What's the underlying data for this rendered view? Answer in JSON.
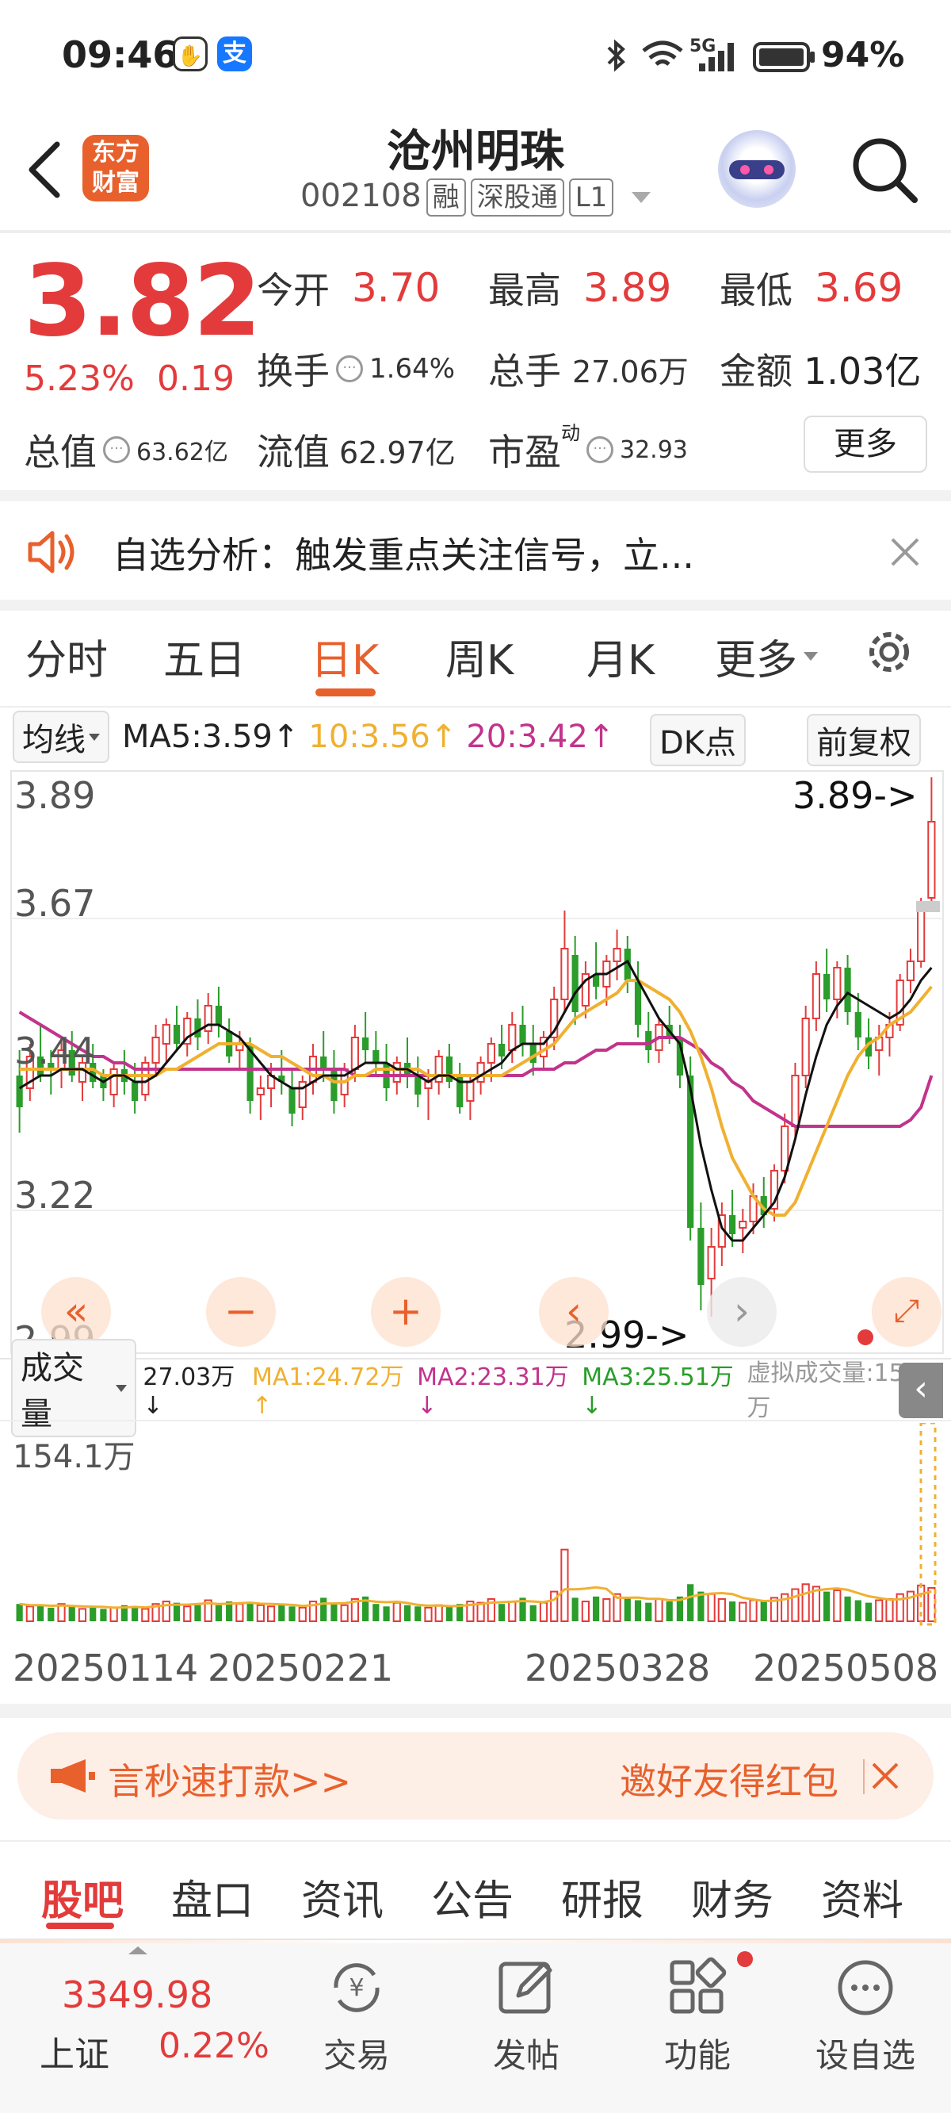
{
  "status_bar": {
    "time": "09:46",
    "badge1": "✋",
    "badge2": "支",
    "network": "5G",
    "battery": "94%"
  },
  "header": {
    "back_icon": "chevron-left-icon",
    "logo_line1": "东方",
    "logo_line2": "财富",
    "title": "沧州明珠",
    "code": "002108",
    "tag_margin": "融",
    "tag_connect": "深股通",
    "tag_level": "L1"
  },
  "quote": {
    "price": "3.82",
    "change_pct": "5.23%",
    "change_amt": "0.19",
    "open_label": "今开",
    "open": "3.70",
    "high_label": "最高",
    "high": "3.89",
    "low_label": "最低",
    "low": "3.69",
    "turnover_label": "换手",
    "turnover": "1.64%",
    "volume_label": "总手",
    "volume": "27.06万",
    "amount_label": "金额",
    "amount": "1.03亿",
    "mcap_label": "总值",
    "mcap": "63.62亿",
    "float_label": "流值",
    "float": "62.97亿",
    "pe_label": "市盈",
    "pe_sup": "动",
    "pe": "32.93",
    "more_label": "更多"
  },
  "notice": {
    "text": "自选分析：触发重点关注信号，立..."
  },
  "chart_tabs": [
    "分时",
    "五日",
    "日K",
    "周K",
    "月K",
    "更多"
  ],
  "active_chart_tab": 2,
  "ma_bar": {
    "mode": "均线",
    "ma5": "MA5:3.59↑",
    "ma10": "10:3.56↑",
    "ma20": "20:3.42↑",
    "dk": "DK点",
    "adjust": "前复权"
  },
  "colors": {
    "up": "#e33b3b",
    "down": "#2a9d2a",
    "accent": "#e8602c",
    "ma5": "#111111",
    "ma10": "#f0b030",
    "ma20": "#c2338c"
  },
  "price_chart": {
    "y_labels": [
      "3.89",
      "3.67",
      "3.44",
      "3.22",
      "2.99"
    ],
    "max_label": "3.89->",
    "min_label": "2.99->"
  },
  "volume_bar": {
    "mode": "成交量",
    "vol": "27.03万↓",
    "ma1": "MA1:24.72万↑",
    "ma2": "MA2:23.31万↓",
    "ma3": "MA3:25.51万↓",
    "virtual": "虚拟成交量:154.1万",
    "max_label": "154.1万"
  },
  "chart_data": {
    "type": "candlestick",
    "ylim": [
      2.99,
      3.89
    ],
    "x_tick_labels": [
      "20250114",
      "20250221",
      "20250328",
      "20250508"
    ],
    "candles": [
      [
        3.42,
        3.46,
        3.33,
        3.37
      ],
      [
        3.4,
        3.47,
        3.38,
        3.45
      ],
      [
        3.45,
        3.5,
        3.41,
        3.42
      ],
      [
        3.44,
        3.46,
        3.39,
        3.43
      ],
      [
        3.43,
        3.48,
        3.4,
        3.46
      ],
      [
        3.46,
        3.49,
        3.41,
        3.42
      ],
      [
        3.41,
        3.45,
        3.38,
        3.44
      ],
      [
        3.44,
        3.47,
        3.4,
        3.41
      ],
      [
        3.42,
        3.43,
        3.38,
        3.4
      ],
      [
        3.39,
        3.44,
        3.37,
        3.43
      ],
      [
        3.43,
        3.46,
        3.39,
        3.41
      ],
      [
        3.41,
        3.44,
        3.36,
        3.38
      ],
      [
        3.39,
        3.45,
        3.38,
        3.44
      ],
      [
        3.44,
        3.5,
        3.42,
        3.48
      ],
      [
        3.47,
        3.51,
        3.44,
        3.5
      ],
      [
        3.5,
        3.53,
        3.46,
        3.47
      ],
      [
        3.47,
        3.52,
        3.45,
        3.51
      ],
      [
        3.51,
        3.54,
        3.46,
        3.48
      ],
      [
        3.49,
        3.55,
        3.47,
        3.53
      ],
      [
        3.53,
        3.56,
        3.48,
        3.5
      ],
      [
        3.49,
        3.51,
        3.44,
        3.45
      ],
      [
        3.46,
        3.49,
        3.43,
        3.47
      ],
      [
        3.47,
        3.48,
        3.36,
        3.38
      ],
      [
        3.39,
        3.42,
        3.35,
        3.4
      ],
      [
        3.4,
        3.44,
        3.37,
        3.42
      ],
      [
        3.42,
        3.46,
        3.39,
        3.41
      ],
      [
        3.4,
        3.43,
        3.34,
        3.36
      ],
      [
        3.37,
        3.42,
        3.35,
        3.41
      ],
      [
        3.41,
        3.47,
        3.39,
        3.45
      ],
      [
        3.45,
        3.49,
        3.41,
        3.43
      ],
      [
        3.43,
        3.46,
        3.36,
        3.38
      ],
      [
        3.39,
        3.44,
        3.37,
        3.43
      ],
      [
        3.43,
        3.5,
        3.41,
        3.48
      ],
      [
        3.48,
        3.52,
        3.44,
        3.46
      ],
      [
        3.46,
        3.49,
        3.42,
        3.44
      ],
      [
        3.44,
        3.47,
        3.38,
        3.4
      ],
      [
        3.41,
        3.45,
        3.39,
        3.44
      ],
      [
        3.44,
        3.48,
        3.4,
        3.42
      ],
      [
        3.42,
        3.45,
        3.37,
        3.39
      ],
      [
        3.4,
        3.43,
        3.35,
        3.41
      ],
      [
        3.41,
        3.46,
        3.39,
        3.45
      ],
      [
        3.45,
        3.47,
        3.4,
        3.41
      ],
      [
        3.42,
        3.44,
        3.36,
        3.37
      ],
      [
        3.38,
        3.42,
        3.35,
        3.41
      ],
      [
        3.41,
        3.45,
        3.39,
        3.44
      ],
      [
        3.44,
        3.48,
        3.41,
        3.47
      ],
      [
        3.47,
        3.5,
        3.43,
        3.45
      ],
      [
        3.46,
        3.52,
        3.44,
        3.5
      ],
      [
        3.5,
        3.53,
        3.45,
        3.47
      ],
      [
        3.47,
        3.5,
        3.42,
        3.44
      ],
      [
        3.45,
        3.49,
        3.43,
        3.48
      ],
      [
        3.48,
        3.56,
        3.46,
        3.54
      ],
      [
        3.54,
        3.68,
        3.52,
        3.62
      ],
      [
        3.61,
        3.64,
        3.5,
        3.52
      ],
      [
        3.53,
        3.6,
        3.51,
        3.58
      ],
      [
        3.58,
        3.63,
        3.54,
        3.56
      ],
      [
        3.56,
        3.61,
        3.53,
        3.6
      ],
      [
        3.6,
        3.65,
        3.57,
        3.62
      ],
      [
        3.62,
        3.64,
        3.55,
        3.57
      ],
      [
        3.57,
        3.6,
        3.48,
        3.5
      ],
      [
        3.49,
        3.52,
        3.44,
        3.46
      ],
      [
        3.46,
        3.51,
        3.44,
        3.5
      ],
      [
        3.5,
        3.53,
        3.47,
        3.48
      ],
      [
        3.48,
        3.5,
        3.4,
        3.42
      ],
      [
        3.42,
        3.45,
        3.16,
        3.18
      ],
      [
        3.18,
        3.22,
        3.05,
        3.09
      ],
      [
        3.1,
        3.18,
        3.04,
        3.15
      ],
      [
        3.15,
        3.22,
        3.12,
        3.2
      ],
      [
        3.2,
        3.24,
        3.15,
        3.17
      ],
      [
        3.18,
        3.21,
        3.14,
        3.19
      ],
      [
        3.19,
        3.25,
        3.17,
        3.23
      ],
      [
        3.23,
        3.26,
        3.18,
        3.2
      ],
      [
        3.21,
        3.28,
        3.19,
        3.27
      ],
      [
        3.27,
        3.36,
        3.25,
        3.34
      ],
      [
        3.34,
        3.44,
        3.32,
        3.42
      ],
      [
        3.42,
        3.53,
        3.4,
        3.51
      ],
      [
        3.51,
        3.6,
        3.49,
        3.58
      ],
      [
        3.58,
        3.62,
        3.52,
        3.54
      ],
      [
        3.54,
        3.6,
        3.51,
        3.59
      ],
      [
        3.59,
        3.61,
        3.5,
        3.52
      ],
      [
        3.52,
        3.55,
        3.46,
        3.48
      ],
      [
        3.48,
        3.51,
        3.43,
        3.45
      ],
      [
        3.46,
        3.5,
        3.42,
        3.48
      ],
      [
        3.48,
        3.52,
        3.45,
        3.5
      ],
      [
        3.5,
        3.58,
        3.49,
        3.57
      ],
      [
        3.57,
        3.62,
        3.55,
        3.6
      ],
      [
        3.6,
        3.7,
        3.59,
        3.68
      ],
      [
        3.7,
        3.89,
        3.69,
        3.82
      ]
    ],
    "ma5": [
      3.4,
      3.41,
      3.42,
      3.42,
      3.43,
      3.43,
      3.43,
      3.42,
      3.41,
      3.42,
      3.42,
      3.41,
      3.41,
      3.42,
      3.44,
      3.46,
      3.48,
      3.49,
      3.5,
      3.5,
      3.49,
      3.48,
      3.46,
      3.44,
      3.42,
      3.41,
      3.4,
      3.4,
      3.41,
      3.42,
      3.42,
      3.42,
      3.43,
      3.44,
      3.44,
      3.44,
      3.43,
      3.43,
      3.42,
      3.41,
      3.42,
      3.42,
      3.41,
      3.41,
      3.42,
      3.43,
      3.44,
      3.46,
      3.47,
      3.47,
      3.47,
      3.49,
      3.52,
      3.55,
      3.57,
      3.58,
      3.58,
      3.59,
      3.6,
      3.57,
      3.54,
      3.51,
      3.49,
      3.47,
      3.4,
      3.31,
      3.24,
      3.18,
      3.16,
      3.16,
      3.18,
      3.2,
      3.22,
      3.26,
      3.32,
      3.39,
      3.45,
      3.5,
      3.53,
      3.55,
      3.54,
      3.53,
      3.52,
      3.51,
      3.52,
      3.54,
      3.57,
      3.59
    ],
    "ma10": [
      3.43,
      3.43,
      3.43,
      3.43,
      3.43,
      3.43,
      3.43,
      3.43,
      3.42,
      3.42,
      3.42,
      3.42,
      3.42,
      3.42,
      3.43,
      3.43,
      3.44,
      3.45,
      3.46,
      3.47,
      3.47,
      3.47,
      3.47,
      3.46,
      3.45,
      3.45,
      3.44,
      3.43,
      3.42,
      3.42,
      3.41,
      3.41,
      3.42,
      3.42,
      3.43,
      3.43,
      3.43,
      3.43,
      3.43,
      3.42,
      3.42,
      3.42,
      3.42,
      3.42,
      3.42,
      3.42,
      3.42,
      3.43,
      3.44,
      3.45,
      3.46,
      3.47,
      3.49,
      3.51,
      3.52,
      3.53,
      3.54,
      3.55,
      3.57,
      3.57,
      3.56,
      3.55,
      3.54,
      3.52,
      3.49,
      3.45,
      3.4,
      3.34,
      3.29,
      3.26,
      3.23,
      3.21,
      3.2,
      3.2,
      3.22,
      3.26,
      3.3,
      3.34,
      3.38,
      3.42,
      3.45,
      3.47,
      3.48,
      3.5,
      3.51,
      3.52,
      3.54,
      3.56
    ],
    "ma20": [
      3.52,
      3.51,
      3.5,
      3.49,
      3.48,
      3.47,
      3.46,
      3.45,
      3.45,
      3.44,
      3.44,
      3.43,
      3.43,
      3.43,
      3.43,
      3.43,
      3.43,
      3.43,
      3.43,
      3.43,
      3.43,
      3.43,
      3.43,
      3.43,
      3.43,
      3.43,
      3.43,
      3.43,
      3.43,
      3.43,
      3.43,
      3.43,
      3.42,
      3.42,
      3.42,
      3.42,
      3.42,
      3.42,
      3.42,
      3.42,
      3.42,
      3.42,
      3.42,
      3.42,
      3.42,
      3.42,
      3.42,
      3.42,
      3.42,
      3.43,
      3.43,
      3.43,
      3.44,
      3.44,
      3.45,
      3.46,
      3.46,
      3.47,
      3.47,
      3.47,
      3.47,
      3.48,
      3.48,
      3.48,
      3.47,
      3.46,
      3.44,
      3.43,
      3.41,
      3.4,
      3.38,
      3.37,
      3.36,
      3.35,
      3.34,
      3.34,
      3.34,
      3.34,
      3.34,
      3.34,
      3.34,
      3.34,
      3.34,
      3.34,
      3.34,
      3.35,
      3.37,
      3.42
    ],
    "volume_wan": [
      14,
      12,
      13,
      11,
      14,
      12,
      10,
      12,
      10,
      11,
      13,
      12,
      10,
      14,
      16,
      15,
      12,
      13,
      17,
      13,
      16,
      14,
      15,
      13,
      12,
      14,
      12,
      11,
      16,
      19,
      14,
      13,
      18,
      20,
      14,
      12,
      15,
      13,
      12,
      11,
      13,
      12,
      14,
      16,
      15,
      18,
      14,
      16,
      19,
      13,
      15,
      24,
      58,
      19,
      16,
      20,
      18,
      22,
      19,
      17,
      15,
      18,
      16,
      20,
      30,
      24,
      22,
      18,
      16,
      15,
      17,
      16,
      19,
      22,
      26,
      30,
      28,
      24,
      25,
      20,
      17,
      15,
      17,
      18,
      22,
      24,
      29,
      27
    ]
  },
  "banner": {
    "text_left": "言秒速打款>>",
    "text_right": "邀好友得红包"
  },
  "bottom_tabs": [
    "股吧",
    "盘口",
    "资讯",
    "公告",
    "研报",
    "财务",
    "资料"
  ],
  "active_bottom_tab": 0,
  "nav": {
    "index_value": "3349.98",
    "index_name": "上证",
    "index_pct": "0.22%",
    "items": [
      {
        "label": "交易",
        "icon": "yen-exchange-icon"
      },
      {
        "label": "发帖",
        "icon": "edit-icon"
      },
      {
        "label": "功能",
        "icon": "grid-icon"
      },
      {
        "label": "设自选",
        "icon": "chat-dots-icon"
      }
    ]
  }
}
